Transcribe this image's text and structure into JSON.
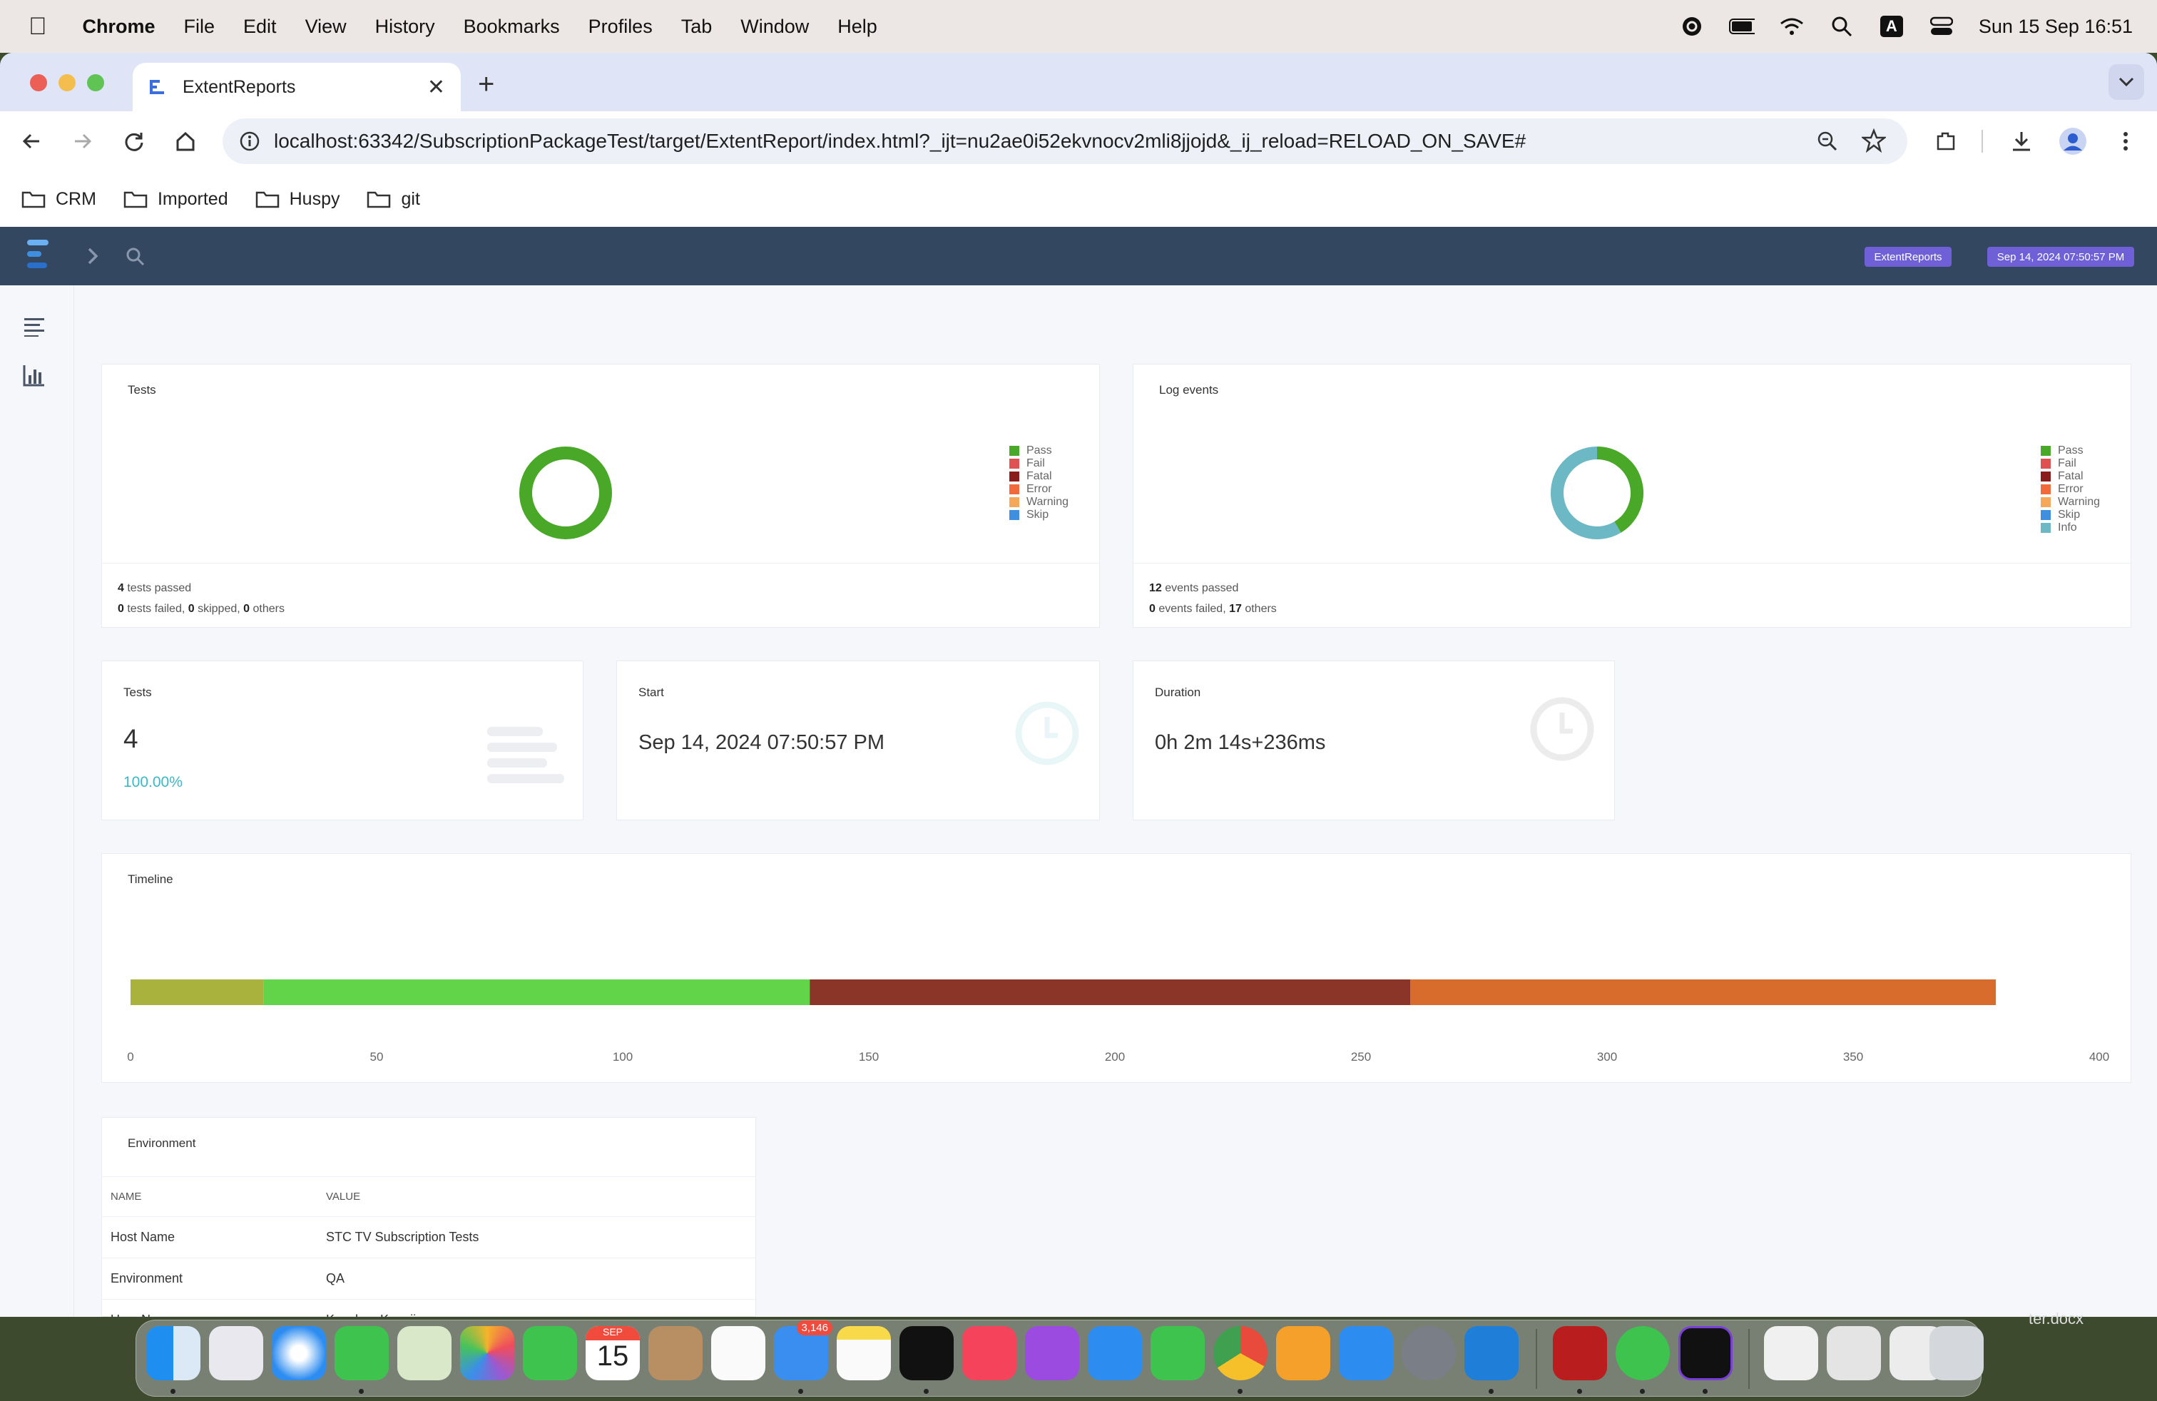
{
  "menubar": {
    "app_name": "Chrome",
    "items": [
      "File",
      "Edit",
      "View",
      "History",
      "Bookmarks",
      "Profiles",
      "Tab",
      "Window",
      "Help"
    ],
    "status_icons": [
      "grammarly-icon",
      "battery-icon",
      "wifi-icon",
      "spotlight-icon",
      "input-source-icon",
      "control-center-icon"
    ],
    "input_source": "A",
    "datetime": "Sun 15 Sep  16:51"
  },
  "browser": {
    "tab_title": "ExtentReports",
    "new_tab": "+",
    "url": "localhost:63342/SubscriptionPackageTest/target/ExtentReport/index.html?_ijt=nu2ae0i52ekvnocv2mli8jjojd&_ij_reload=RELOAD_ON_SAVE#",
    "bookmarks": [
      "CRM",
      "Imported",
      "Huspy",
      "git"
    ]
  },
  "report": {
    "brand_badge": "ExtentReports",
    "date_badge": "Sep 14, 2024 07:50:57 PM",
    "tests_chart": {
      "title": "Tests",
      "legend": [
        "Pass",
        "Fail",
        "Fatal",
        "Error",
        "Warning",
        "Skip"
      ],
      "summary1_count": "4",
      "summary1_text": " tests passed",
      "summary2_failed": "0",
      "summary2_failed_text": " tests failed, ",
      "summary2_skipped": "0",
      "summary2_skipped_text": " skipped, ",
      "summary2_others": "0",
      "summary2_others_text": " others"
    },
    "log_chart": {
      "title": "Log events",
      "legend": [
        "Pass",
        "Fail",
        "Fatal",
        "Error",
        "Warning",
        "Skip",
        "Info"
      ],
      "summary1_count": "12",
      "summary1_text": " events passed",
      "summary2_failed": "0",
      "summary2_failed_text": " events failed, ",
      "summary2_others": "17",
      "summary2_others_text": " others"
    },
    "tests_card": {
      "title": "Tests",
      "value": "4",
      "percent": "100.00%"
    },
    "start_card": {
      "title": "Start",
      "value": "Sep 14, 2024 07:50:57 PM"
    },
    "duration_card": {
      "title": "Duration",
      "value": "0h 2m 14s+236ms"
    },
    "timeline": {
      "title": "Timeline"
    },
    "environment": {
      "title": "Environment",
      "col_name": "NAME",
      "col_value": "VALUE",
      "rows": [
        {
          "name": "Host Name",
          "value": "STC TV Subscription Tests"
        },
        {
          "name": "Environment",
          "value": "QA"
        },
        {
          "name": "User Name",
          "value": "Kanchan Kanojia"
        }
      ]
    }
  },
  "colors": {
    "pass": "#4aa828",
    "fail": "#e05252",
    "fatal": "#8a1c1c",
    "error": "#f06a3c",
    "warning": "#f5a85a",
    "skip": "#3f8fe0",
    "info": "#6cb8c4",
    "nav": "#344761",
    "badge": "#6f60d8"
  },
  "chart_data": [
    {
      "type": "pie",
      "title": "Tests",
      "categories": [
        "Pass",
        "Fail",
        "Fatal",
        "Error",
        "Warning",
        "Skip"
      ],
      "values": [
        4,
        0,
        0,
        0,
        0,
        0
      ]
    },
    {
      "type": "pie",
      "title": "Log events",
      "categories": [
        "Pass",
        "Fail",
        "Fatal",
        "Error",
        "Warning",
        "Skip",
        "Info"
      ],
      "values": [
        12,
        0,
        0,
        0,
        0,
        0,
        17
      ]
    },
    {
      "type": "bar",
      "title": "Timeline",
      "orientation": "horizontal-stacked",
      "xlim": [
        0,
        400
      ],
      "xticks": [
        0,
        50,
        100,
        150,
        200,
        250,
        300,
        350,
        400
      ],
      "segments": [
        {
          "start": 0,
          "end": 27,
          "color": "#a9b23c"
        },
        {
          "start": 27,
          "end": 138,
          "color": "#62d44a"
        },
        {
          "start": 138,
          "end": 260,
          "color": "#8b3528"
        },
        {
          "start": 260,
          "end": 379,
          "color": "#d86c2c"
        }
      ]
    }
  ],
  "dock": {
    "calendar_month": "SEP",
    "calendar_day": "15",
    "mail_badge": "3,146",
    "finder_file": "ter.docx"
  }
}
